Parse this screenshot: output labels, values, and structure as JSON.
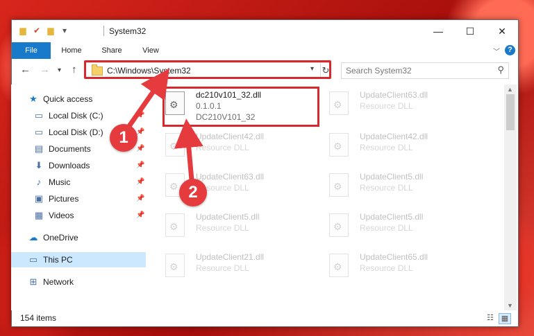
{
  "window": {
    "title": "System32",
    "qa_icons": [
      "folder-icon",
      "properties-icon",
      "new-folder-icon",
      "customize-icon"
    ],
    "controls": {
      "minimize": "—",
      "maximize": "☐",
      "close": "✕"
    }
  },
  "ribbon": {
    "tabs": [
      "File",
      "Home",
      "Share",
      "View"
    ],
    "help": "?"
  },
  "address": {
    "path": "C:\\Windows\\System32",
    "refresh_glyph": "↻"
  },
  "search": {
    "placeholder": "Search System32"
  },
  "nav": {
    "items": [
      {
        "label": "Quick access",
        "icon": "★",
        "pinned": false
      },
      {
        "label": "Local Disk (C:)",
        "icon": "▭",
        "pinned": true
      },
      {
        "label": "Local Disk (D:)",
        "icon": "▭",
        "pinned": true
      },
      {
        "label": "Documents",
        "icon": "▤",
        "pinned": true
      },
      {
        "label": "Downloads",
        "icon": "⬇",
        "pinned": true
      },
      {
        "label": "Music",
        "icon": "♪",
        "pinned": true
      },
      {
        "label": "Pictures",
        "icon": "▣",
        "pinned": true
      },
      {
        "label": "Videos",
        "icon": "▦",
        "pinned": true
      },
      {
        "label": "OneDrive",
        "icon": "☁",
        "pinned": false
      },
      {
        "label": "This PC",
        "icon": "▭",
        "pinned": false
      },
      {
        "label": "Network",
        "icon": "⊞",
        "pinned": false
      }
    ]
  },
  "files": {
    "highlighted": {
      "name": "dc210v101_32.dll",
      "version": "0.1.0.1",
      "desc": "DC210V101_32"
    },
    "faded": [
      {
        "name": "UpdateClient63.dll",
        "desc": "Resource DLL"
      },
      {
        "name": "UpdateClient42.dll",
        "desc": "Resource DLL"
      },
      {
        "name": "UpdateClient42.dll",
        "desc": "Resource DLL"
      },
      {
        "name": "UpdateClient63.dll",
        "desc": "Resource DLL"
      },
      {
        "name": "UpdateClient5.dll",
        "desc": "Resource DLL"
      },
      {
        "name": "UpdateClient5.dll",
        "desc": "Resource DLL"
      },
      {
        "name": "UpdateClient5.dll",
        "desc": "Resource DLL"
      },
      {
        "name": "UpdateClient21.dll",
        "desc": "Resource DLL"
      },
      {
        "name": "UpdateClient65.dll",
        "desc": "Resource DLL"
      }
    ]
  },
  "status": {
    "count": "154 items"
  },
  "markers": [
    "1",
    "2"
  ],
  "colors": {
    "accent": "#1979ca",
    "highlight": "#d9272e",
    "marker": "#e53b3f"
  }
}
